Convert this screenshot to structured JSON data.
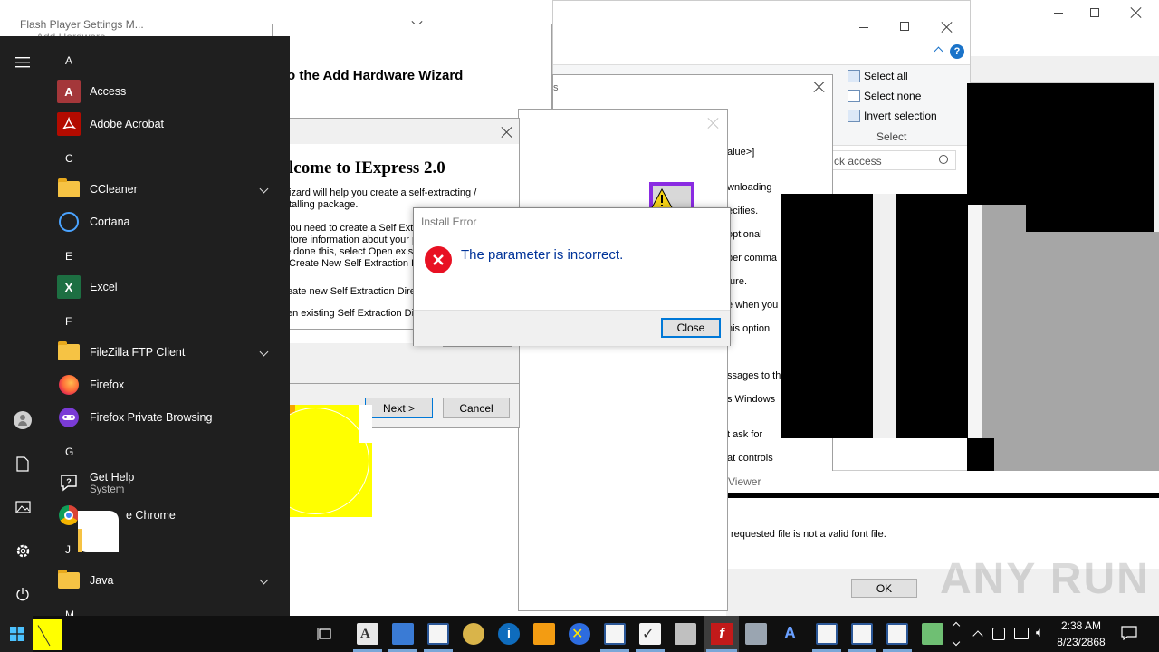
{
  "background_windows": {
    "font_viewer_title": "Flash Player Settings M...",
    "add_hardware_tab": "Add Hardware",
    "add_hardware_heading": "o the Add Hardware Wizard",
    "iexpress_cancel_fragment": "el",
    "char_fragment": "s",
    "ribbon": {
      "select_all": "Select all",
      "select_none": "Select none",
      "invert_selection": "Invert selection",
      "group_label": "Select"
    },
    "quick_access_placeholder": "ck access",
    "options_lines": [
      "alue>]",
      "wnloading",
      "ecifies.",
      "optional",
      "per comma",
      "ture.",
      "e when you",
      "his option",
      "ssages to th",
      "s Windows",
      "t ask for",
      "at controls"
    ],
    "font_viewer": {
      "title_fragment": "Viewer",
      "message": "requested file  is not a valid font file.",
      "ok_label": "OK"
    }
  },
  "iexpress_wizard": {
    "heading": "lcome to IExpress 2.0",
    "para1_line1": "izard will help you create a self-extracting /",
    "para1_line2": "talling package.",
    "para2_line1": "you need to create a Self Extra",
    "para2_line2": "store information about your pa",
    "para2_line3": "e done this, select Open existi",
    "para2_line4": "Create New Self Extraction Di",
    "radio1": "eate new Self Extraction Direc",
    "radio2": "en existing Self Extraction Dir",
    "next_label": "Next >",
    "cancel_label": "Cancel"
  },
  "install_error": {
    "title": "Install Error",
    "message": "The parameter is incorrect.",
    "close_label": "Close"
  },
  "start_menu": {
    "groups": [
      {
        "letter": "A"
      },
      {
        "letter": "C"
      },
      {
        "letter": "E"
      },
      {
        "letter": "F"
      },
      {
        "letter": "G"
      },
      {
        "letter": "J"
      },
      {
        "letter": "M"
      }
    ],
    "apps": {
      "access": "Access",
      "acrobat": "Adobe Acrobat",
      "ccleaner": "CCleaner",
      "cortana": "Cortana",
      "excel": "Excel",
      "filezilla": "FileZilla FTP Client",
      "firefox": "Firefox",
      "firefox_private": "Firefox Private Browsing",
      "get_help": "Get Help",
      "get_help_sub": "System",
      "chrome": "e Chrome",
      "java": "Java"
    },
    "access_icon_letter": "A",
    "excel_icon_letter": "X"
  },
  "taskbar": {
    "time": "2:38 AM",
    "date": "8/23/2868"
  },
  "watermark": "ANY RUN",
  "colors": {
    "start_bg": "#1f1f1f",
    "taskbar_bg": "#101010",
    "error_red": "#e81123",
    "link_blue": "#003399",
    "access_red": "#a4373a",
    "excel_green": "#1d6f42",
    "acrobat_red": "#b30b00"
  }
}
